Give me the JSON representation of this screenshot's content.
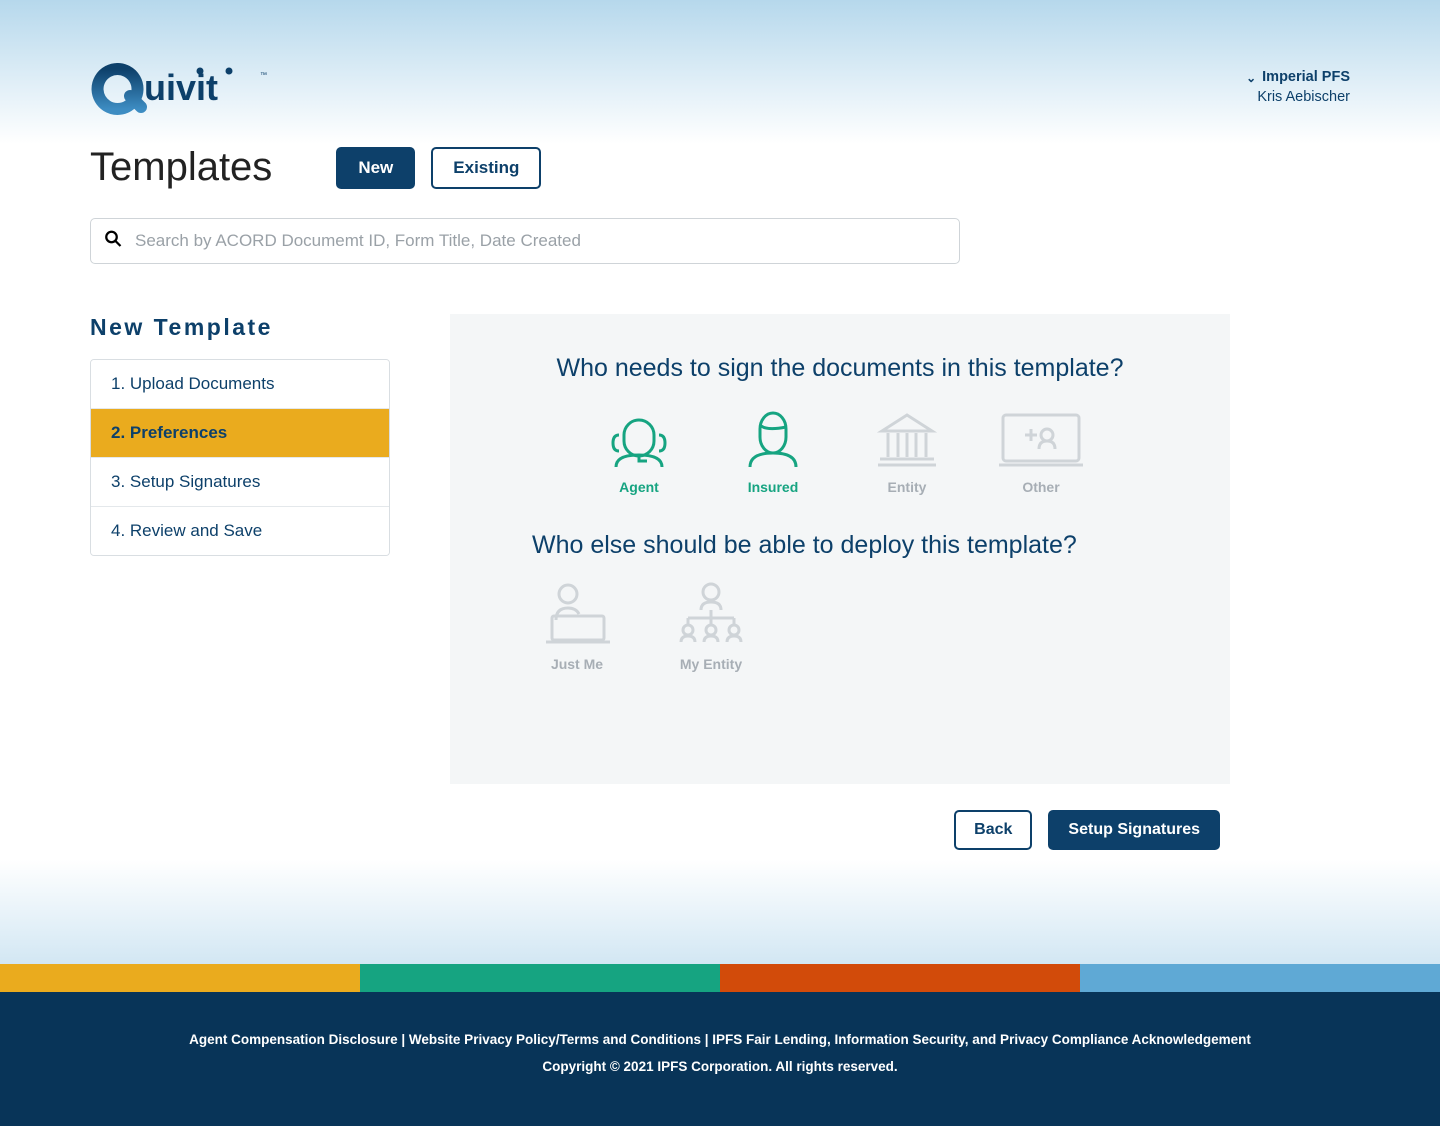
{
  "header": {
    "company": "Imperial PFS",
    "user_name": "Kris Aebischer"
  },
  "page": {
    "title": "Templates"
  },
  "tabs": {
    "new": "New",
    "existing": "Existing"
  },
  "search": {
    "placeholder": "Search by ACORD Documemt ID, Form Title, Date Created"
  },
  "sidebar": {
    "heading": "New Template",
    "steps": [
      "1. Upload Documents",
      "2. Preferences",
      "3. Setup Signatures",
      "4. Review and Save"
    ]
  },
  "prefs": {
    "sign_question": "Who needs to sign the documents in this template?",
    "sign_options": {
      "agent": "Agent",
      "insured": "Insured",
      "entity": "Entity",
      "other": "Other"
    },
    "deploy_question": "Who else should be able to deploy this template?",
    "deploy_options": {
      "just_me": "Just Me",
      "my_entity": "My Entity"
    }
  },
  "actions": {
    "back": "Back",
    "next": "Setup Signatures"
  },
  "footer": {
    "links": "Agent Compensation Disclosure | Website Privacy Policy/Terms and Conditions | IPFS Fair Lending, Information Security, and Privacy Compliance Acknowledgement",
    "copyright": "Copyright © 2021 IPFS Corporation. All rights reserved."
  }
}
